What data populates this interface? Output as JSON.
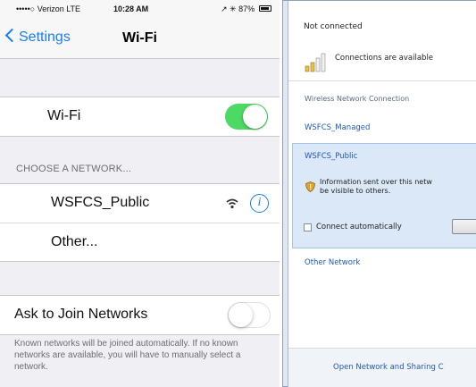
{
  "ios": {
    "status_bar": {
      "carrier": "•••••○ Verizon  LTE",
      "time": "10:28 AM",
      "right": "↗ ✳ 87%"
    },
    "nav": {
      "back_label": "Settings",
      "title": "Wi-Fi"
    },
    "wifi_row": {
      "label": "Wi-Fi",
      "toggle": "on"
    },
    "section_header": "CHOOSE A NETWORK...",
    "networks": [
      {
        "name": "WSFCS_Public"
      },
      {
        "name": "Other..."
      }
    ],
    "ask_row": {
      "label": "Ask to Join Networks",
      "toggle": "off"
    },
    "footer": "Known networks will be joined automatically. If no known networks are available, you will have to manually select a network."
  },
  "windows": {
    "status": "Not connected",
    "available": "Connections are available",
    "section": "Wireless Network Connection",
    "networks": [
      "WSFCS_Managed",
      "WSFCS_Public",
      "Other Network"
    ],
    "info_line1": "Information sent over this netw",
    "info_line2": "be visible to others.",
    "connect_auto": "Connect automatically",
    "sharing_link": "Open Network and Sharing C"
  },
  "colors": {
    "ios_blue": "#1a7cf5",
    "ios_green": "#4cd964",
    "win_link": "#2257b8",
    "win_selected": "#dbe8f7"
  }
}
